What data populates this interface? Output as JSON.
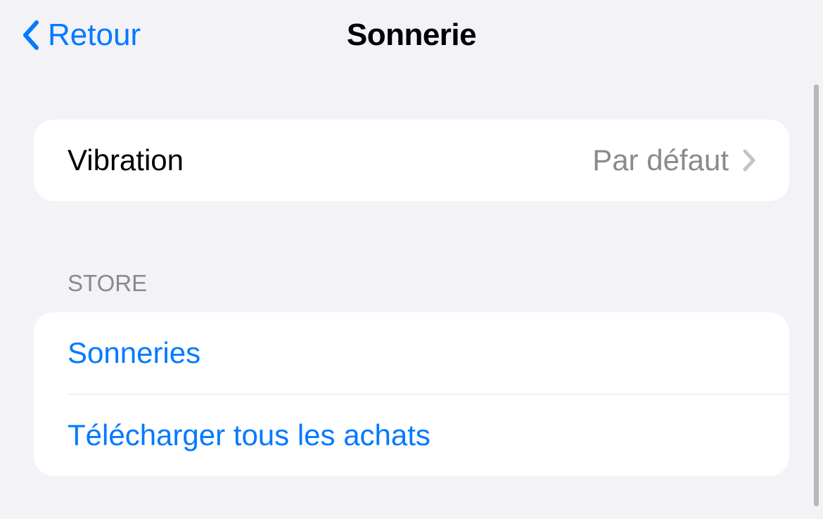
{
  "header": {
    "back_label": "Retour",
    "title": "Sonnerie"
  },
  "vibration_group": {
    "label": "Vibration",
    "value": "Par défaut"
  },
  "store_section": {
    "header": "STORE",
    "items": [
      {
        "label": "Sonneries"
      },
      {
        "label": "Télécharger tous les achats"
      }
    ]
  }
}
